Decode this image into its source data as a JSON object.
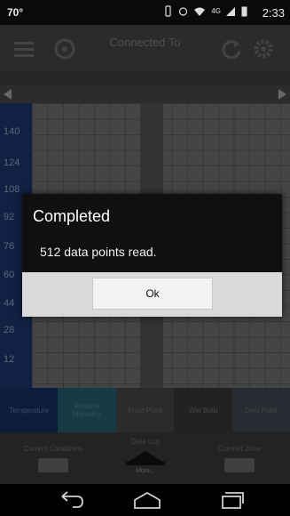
{
  "status_bar": {
    "temperature": "70°",
    "network": "4G",
    "time": "2:33"
  },
  "app_header": {
    "title": "Connected To"
  },
  "chart": {
    "y_ticks": [
      "140",
      "124",
      "108",
      "92",
      "76",
      "60",
      "44",
      "28",
      "12"
    ]
  },
  "tabs": [
    {
      "label": "Temperature"
    },
    {
      "label": "Relative Humidity"
    },
    {
      "label": "Frost Point"
    },
    {
      "label": "Wet Bulb"
    },
    {
      "label": "Dew Point"
    }
  ],
  "controls": {
    "left_label": "Current Conditions",
    "middle_label": "Data Log",
    "middle_more": "More...",
    "right_label": "Comfort Zone"
  },
  "dialog": {
    "title": "Completed",
    "message": "512 data points read.",
    "ok_label": "Ok"
  },
  "colors": {
    "status_bar": "#0a0a0a",
    "y_axis": "#162c5a",
    "dialog_bg": "#101010",
    "dialog_footer": "#d9d9d9"
  },
  "icons": [
    "vibrate-icon",
    "wifi-icon",
    "signal-icon",
    "battery-icon",
    "menu-icon",
    "device-icon",
    "refresh-icon",
    "settings-icon",
    "back-icon",
    "home-icon",
    "recent-apps-icon"
  ]
}
